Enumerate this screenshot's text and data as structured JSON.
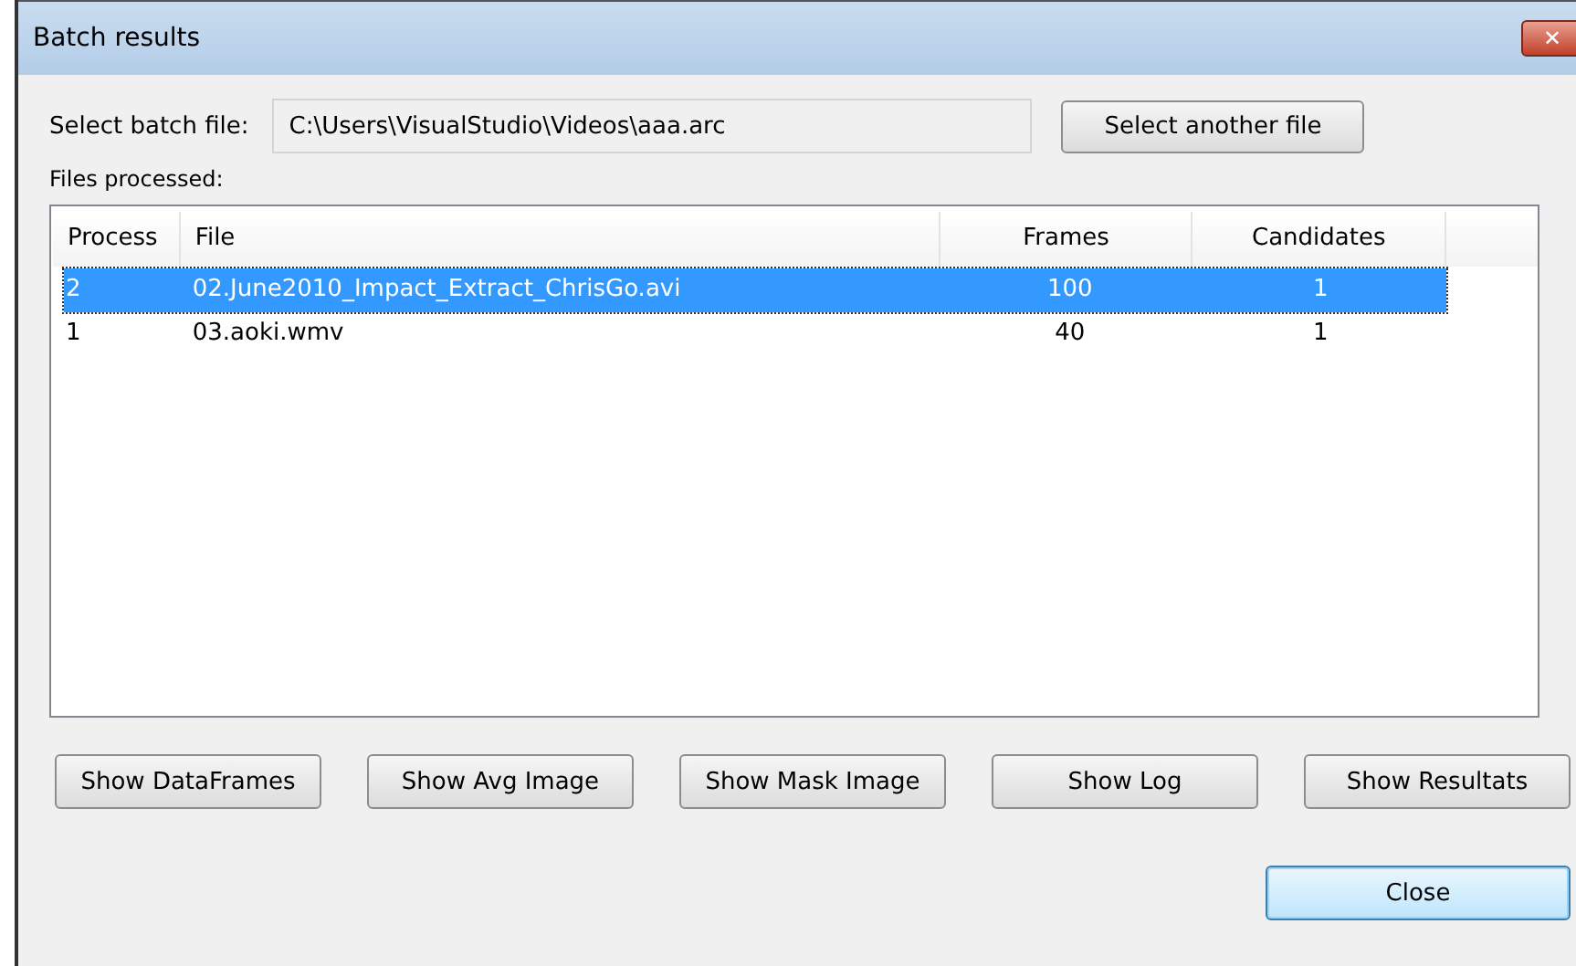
{
  "window": {
    "title": "Batch results",
    "close_glyph": "✕"
  },
  "batch_file": {
    "label": "Select batch file:",
    "value": "C:\\Users\\VisualStudio\\Videos\\aaa.arc",
    "button": "Select another file"
  },
  "files_label": "Files processed:",
  "table": {
    "columns": [
      "Process",
      "File",
      "Frames",
      "Candidates"
    ],
    "rows": [
      {
        "cells": [
          "2",
          "02.June2010_Impact_Extract_ChrisGo.avi",
          "100",
          "1"
        ],
        "selected": true
      },
      {
        "cells": [
          "1",
          "03.aoki.wmv",
          "40",
          "1"
        ],
        "selected": false
      }
    ]
  },
  "buttons": [
    "Show DataFrames",
    "Show Avg Image",
    "Show Mask Image",
    "Show Log",
    "Show Resultats"
  ],
  "close_button": {
    "label": "Close",
    "default": true
  }
}
